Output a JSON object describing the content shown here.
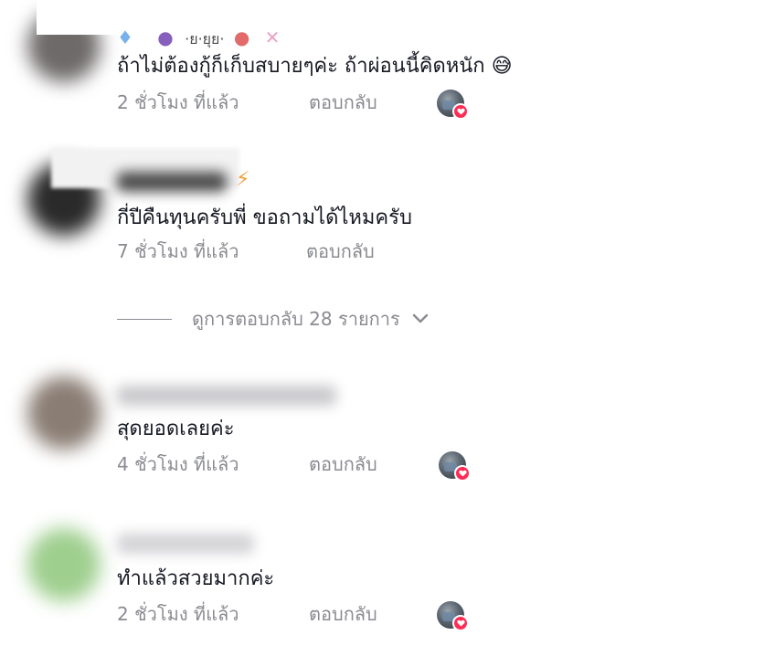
{
  "comments": [
    {
      "text": "ถ้าไม่ต้องกู้ก็เก็บสบายๆค่ะ ถ้าผ่อนนี้คิดหนัก 😅",
      "time": "2 ชั่วโมง ที่แล้ว",
      "reply": "ตอบกลับ",
      "name_emojis": "💧 🍇 ·ย·ยุย· 🍉 🍭",
      "creator_liked": true,
      "avatar_color": "#6e6a6a"
    },
    {
      "text": "กี่ปีคืนทุนครับพี่ ขอถามได้ไหมครับ",
      "time": "7 ชั่วโมง ที่แล้ว",
      "reply": "ตอบกลับ",
      "name_emojis": "⚡",
      "creator_liked": false,
      "avatar_color": "#2a2a2a"
    },
    {
      "text": "สุดยอดเลยค่ะ",
      "time": "4 ชั่วโมง ที่แล้ว",
      "reply": "ตอบกลับ",
      "creator_liked": true,
      "avatar_color": "#8a7d74"
    },
    {
      "text": "ทำแล้วสวยมากค่ะ",
      "time": "2 ชั่วโมง ที่แล้ว",
      "reply": "ตอบกลับ",
      "creator_liked": true,
      "avatar_color": "#9fcf8f"
    }
  ],
  "view_replies": {
    "label": "ดูการตอบกลับ 28 รายการ"
  },
  "icons": {
    "heart": "heart-icon",
    "chevron": "chevron-down-icon"
  },
  "colors": {
    "text": "#161823",
    "muted": "#8a8b91",
    "heart": "#fe2c55"
  }
}
